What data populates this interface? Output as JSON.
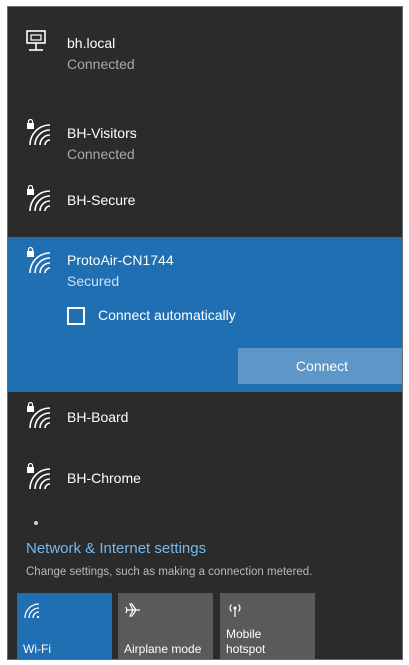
{
  "networks": [
    {
      "name": "bh.local",
      "status": "Connected",
      "icon": "ethernet-icon"
    },
    {
      "name": "BH-Visitors",
      "status": "Connected",
      "icon": "wifi-secured-icon"
    },
    {
      "name": "BH-Secure",
      "status": "",
      "icon": "wifi-secured-icon"
    },
    {
      "name": "ProtoAir-CN1744",
      "status": "Secured",
      "icon": "wifi-secured-icon",
      "selected": true
    },
    {
      "name": "BH-Board",
      "status": "",
      "icon": "wifi-secured-icon"
    },
    {
      "name": "BH-Chrome",
      "status": "",
      "icon": "wifi-secured-icon"
    }
  ],
  "selected_network": {
    "connect_auto_label": "Connect automatically",
    "connect_auto_checked": false,
    "connect_label": "Connect"
  },
  "settings": {
    "link": "Network & Internet settings",
    "description": "Change settings, such as making a connection metered."
  },
  "quick_actions": [
    {
      "label": "Wi-Fi",
      "icon": "wifi-icon",
      "active": true
    },
    {
      "label": "Airplane mode",
      "icon": "airplane-icon",
      "active": false
    },
    {
      "label": "Mobile hotspot",
      "label_line1": "Mobile",
      "label_line2": "hotspot",
      "icon": "hotspot-icon",
      "active": false
    }
  ],
  "colors": {
    "background": "#2b2b2b",
    "accent": "#1f6fb2",
    "link": "#76b9ed"
  }
}
